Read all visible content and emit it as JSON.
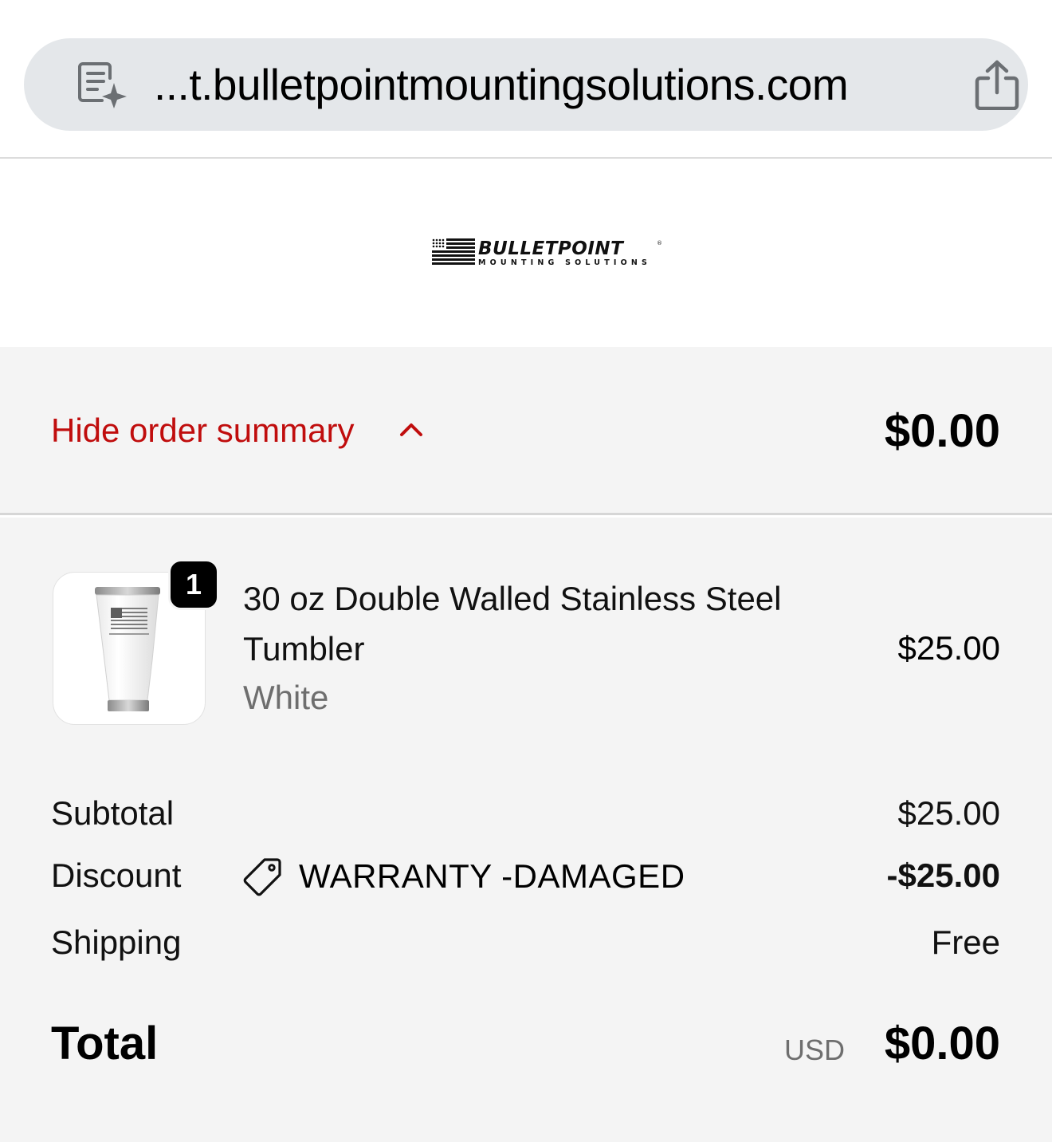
{
  "browser": {
    "url": "...t.bulletpointmountingsolutions.com"
  },
  "logo": {
    "brand": "BULLETPOINT",
    "tagline": "MOUNTING SOLUTIONS",
    "mark": "®"
  },
  "summary_toggle": {
    "label": "Hide order summary",
    "total": "$0.00"
  },
  "line_items": [
    {
      "quantity": "1",
      "name": "30 oz Double Walled Stainless Steel Tumbler",
      "variant": "White",
      "price": "$25.00"
    }
  ],
  "summary": {
    "subtotal_label": "Subtotal",
    "subtotal_value": "$25.00",
    "discount_label": "Discount",
    "discount_code": "WARRANTY -DAMAGED",
    "discount_value": "-$25.00",
    "shipping_label": "Shipping",
    "shipping_value": "Free",
    "total_label": "Total",
    "currency": "USD",
    "total_value": "$0.00"
  },
  "colors": {
    "accent_red": "#c00d0d",
    "panel_bg": "#f4f4f4",
    "urlbar_bg": "#e4e7ea"
  }
}
